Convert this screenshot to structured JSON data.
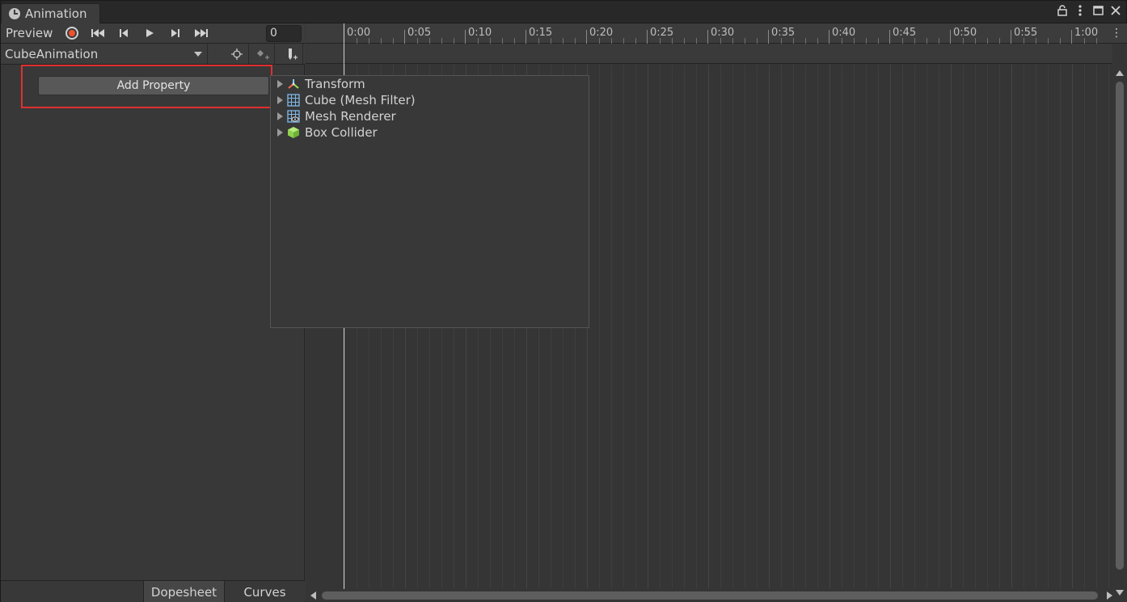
{
  "window": {
    "tab_title": "Animation"
  },
  "toolbar": {
    "preview_label": "Preview",
    "frame_value": "0",
    "clip_name": "CubeAnimation"
  },
  "add_property_label": "Add Property",
  "bottom_tabs": [
    "Dopesheet",
    "Curves"
  ],
  "ruler": {
    "labels": [
      "0:00",
      "0:05",
      "0:10",
      "0:15",
      "0:20",
      "0:25",
      "0:30",
      "0:35",
      "0:40",
      "0:45",
      "0:50",
      "0:55",
      "1:00"
    ]
  },
  "popup_items": [
    {
      "label": "Transform",
      "icon": "transform-icon"
    },
    {
      "label": "Cube (Mesh Filter)",
      "icon": "mesh-filter-icon"
    },
    {
      "label": "Mesh Renderer",
      "icon": "mesh-renderer-icon"
    },
    {
      "label": "Box Collider",
      "icon": "box-collider-icon"
    }
  ],
  "colors": {
    "record": "#f0522e",
    "highlight_border": "#e03030",
    "box_collider": "#8fd14f"
  }
}
